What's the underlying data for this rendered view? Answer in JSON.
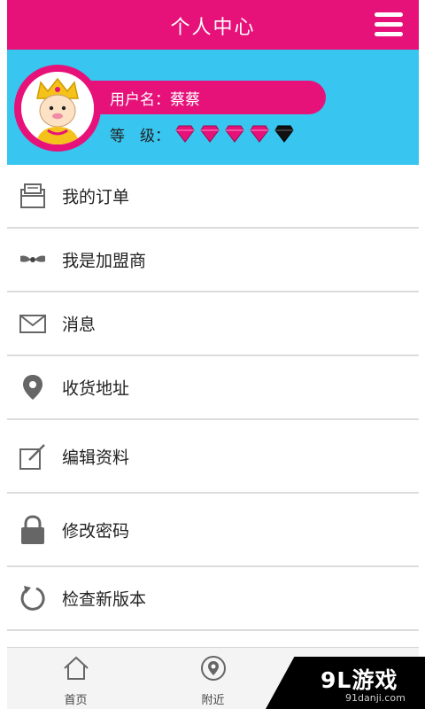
{
  "header": {
    "title": "个人中心"
  },
  "profile": {
    "username_label": "用户名：蔡蔡",
    "level_label": "等　级：",
    "level_gems": [
      "pink",
      "pink",
      "pink",
      "pink",
      "black"
    ]
  },
  "menu": {
    "items": [
      {
        "label": "我的订单",
        "icon": "orders-icon"
      },
      {
        "label": "我是加盟商",
        "icon": "bow-tie-icon"
      },
      {
        "label": "消息",
        "icon": "envelope-icon"
      },
      {
        "label": "收货地址",
        "icon": "location-pin-icon"
      },
      {
        "label": "编辑资料",
        "icon": "edit-icon"
      },
      {
        "label": "修改密码",
        "icon": "lock-icon"
      },
      {
        "label": "检查新版本",
        "icon": "refresh-icon"
      }
    ]
  },
  "tabs": [
    {
      "label": "首页",
      "icon": "home-icon"
    },
    {
      "label": "附近",
      "icon": "location-icon"
    },
    {
      "label": "",
      "icon": "profile-icon"
    }
  ],
  "watermark": {
    "main": "9L游戏",
    "sub": "91danji.com"
  },
  "colors": {
    "accent": "#e6127a",
    "panel": "#38c5ef",
    "gem_pink": "#e6127a",
    "gem_black": "#111111"
  }
}
